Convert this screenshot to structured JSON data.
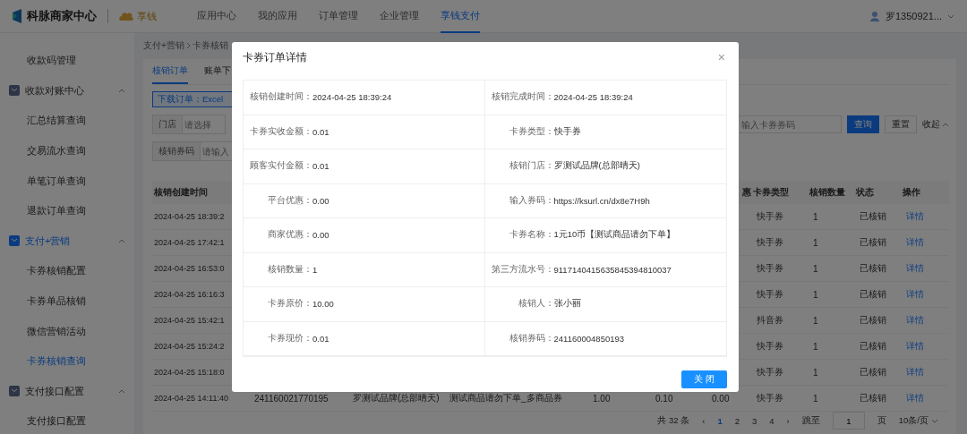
{
  "header": {
    "product": "科脉商家中心",
    "brand": "享钱",
    "nav": [
      {
        "label": "应用中心",
        "selected": false
      },
      {
        "label": "我的应用",
        "selected": false
      },
      {
        "label": "订单管理",
        "selected": false
      },
      {
        "label": "企业管理",
        "selected": false
      },
      {
        "label": "享钱支付",
        "selected": true
      }
    ],
    "user": "罗1350921..."
  },
  "sidebar": {
    "items": [
      {
        "kind": "item",
        "label": "收款码管理",
        "selected": false
      },
      {
        "kind": "group",
        "label": "收款对账中心",
        "selected": false,
        "expanded": true,
        "children": [
          {
            "label": "汇总结算查询",
            "selected": false
          },
          {
            "label": "交易流水查询",
            "selected": false
          },
          {
            "label": "单笔订单查询",
            "selected": false
          },
          {
            "label": "退款订单查询",
            "selected": false
          }
        ]
      },
      {
        "kind": "group",
        "label": "支付+营销",
        "selected": true,
        "expanded": true,
        "children": [
          {
            "label": "卡券核销配置",
            "selected": false
          },
          {
            "label": "卡券单品核销",
            "selected": false
          },
          {
            "label": "微信营销活动",
            "selected": false
          },
          {
            "label": "卡券核销查询",
            "selected": true
          }
        ]
      },
      {
        "kind": "group",
        "label": "支付接口配置",
        "selected": false,
        "expanded": true,
        "children": [
          {
            "label": "支付接口配置",
            "selected": false
          }
        ]
      }
    ]
  },
  "breadcrumb": [
    "支付+营销",
    "卡券核销"
  ],
  "tabs": [
    {
      "label": "核销订单",
      "selected": true
    },
    {
      "label": "账单下",
      "selected": false
    }
  ],
  "download_banner": "下载订单：Excel",
  "filters": {
    "store_label": "门店",
    "store_placeholder": "请选择",
    "code_label": "核销券码",
    "code_placeholder": "请输入",
    "search_placeholder": "输入卡券券码",
    "query_button": "查询",
    "reset_button": "重置",
    "collapse": "收起"
  },
  "table": {
    "columns": [
      "核销创建时间",
      "惠",
      "卡券类型",
      "核销数量",
      "状态",
      "操作"
    ],
    "rows": [
      {
        "time": "2024-04-25 18:39:2",
        "type": "快手券",
        "count": "1",
        "status": "已核销",
        "action": "详情"
      },
      {
        "time": "2024-04-25 17:42:1",
        "type": "快手券",
        "count": "1",
        "status": "已核销",
        "action": "详情"
      },
      {
        "time": "2024-04-25 16:53:0",
        "type": "快手券",
        "count": "1",
        "status": "已核销",
        "action": "详情"
      },
      {
        "time": "2024-04-25 16:16:3",
        "type": "快手券",
        "count": "1",
        "status": "已核销",
        "action": "详情"
      },
      {
        "time": "2024-04-25 15:42:1",
        "type": "抖音券",
        "count": "1",
        "status": "已核销",
        "action": "详情"
      },
      {
        "time": "2024-04-25 15:24:2",
        "type": "快手券",
        "count": "1",
        "status": "已核销",
        "action": "详情"
      },
      {
        "time": "2024-04-25 15:18:0",
        "type": "快手券",
        "count": "1",
        "status": "已核销",
        "action": "详情"
      },
      {
        "time": "2024-04-25 14:11:40",
        "column_2": "241160021770195",
        "column_3": "罗测试品牌(总部晴天)",
        "column_4": "测试商品请勿下单_多商品券",
        "column_5": "1.00",
        "column_6": "0.10",
        "column_7": "0.00",
        "type": "快手券",
        "count": "1",
        "status": "已核销",
        "action": "详情"
      }
    ]
  },
  "pagination": {
    "total": "共 32 条",
    "prev": "‹",
    "pages": [
      {
        "label": "1",
        "selected": true
      },
      {
        "label": "2",
        "selected": false
      },
      {
        "label": "3",
        "selected": false
      },
      {
        "label": "4",
        "selected": false
      }
    ],
    "next": "›",
    "jump_label": "跳至",
    "jump_value": "1",
    "page_unit": "页",
    "page_size": "10条/页"
  },
  "dialog": {
    "title": "卡券订单详情",
    "close": "×",
    "fields": [
      {
        "label": "核销创建时间：",
        "value": "2024-04-25 18:39:24"
      },
      {
        "label": "核销完成时间：",
        "value": "2024-04-25 18:39:24"
      },
      {
        "label": "卡券实收金额：",
        "value": "0.01"
      },
      {
        "label": "卡券类型：",
        "value": "快手券"
      },
      {
        "label": "顾客实付金额：",
        "value": "0.01"
      },
      {
        "label": "核销门店：",
        "value": "罗测试品牌(总部晴天)"
      },
      {
        "label": "平台优惠：",
        "value": "0.00"
      },
      {
        "label": "输入券码：",
        "value": "https://ksurl.cn/dx8e7H9h"
      },
      {
        "label": "商家优惠：",
        "value": "0.00"
      },
      {
        "label": "卡券名称：",
        "value": "1元10币【测试商品请勿下单】"
      },
      {
        "label": "核销数量：",
        "value": "1"
      },
      {
        "label": "第三方流水号：",
        "value": "9117140415635845394810037"
      },
      {
        "label": "卡券原价：",
        "value": "10.00"
      },
      {
        "label": "核销人：",
        "value": "张小丽"
      },
      {
        "label": "卡券现价：",
        "value": "0.01"
      },
      {
        "label": "核销券码：",
        "value": "241160004850193"
      }
    ],
    "close_button": "关 闭"
  }
}
